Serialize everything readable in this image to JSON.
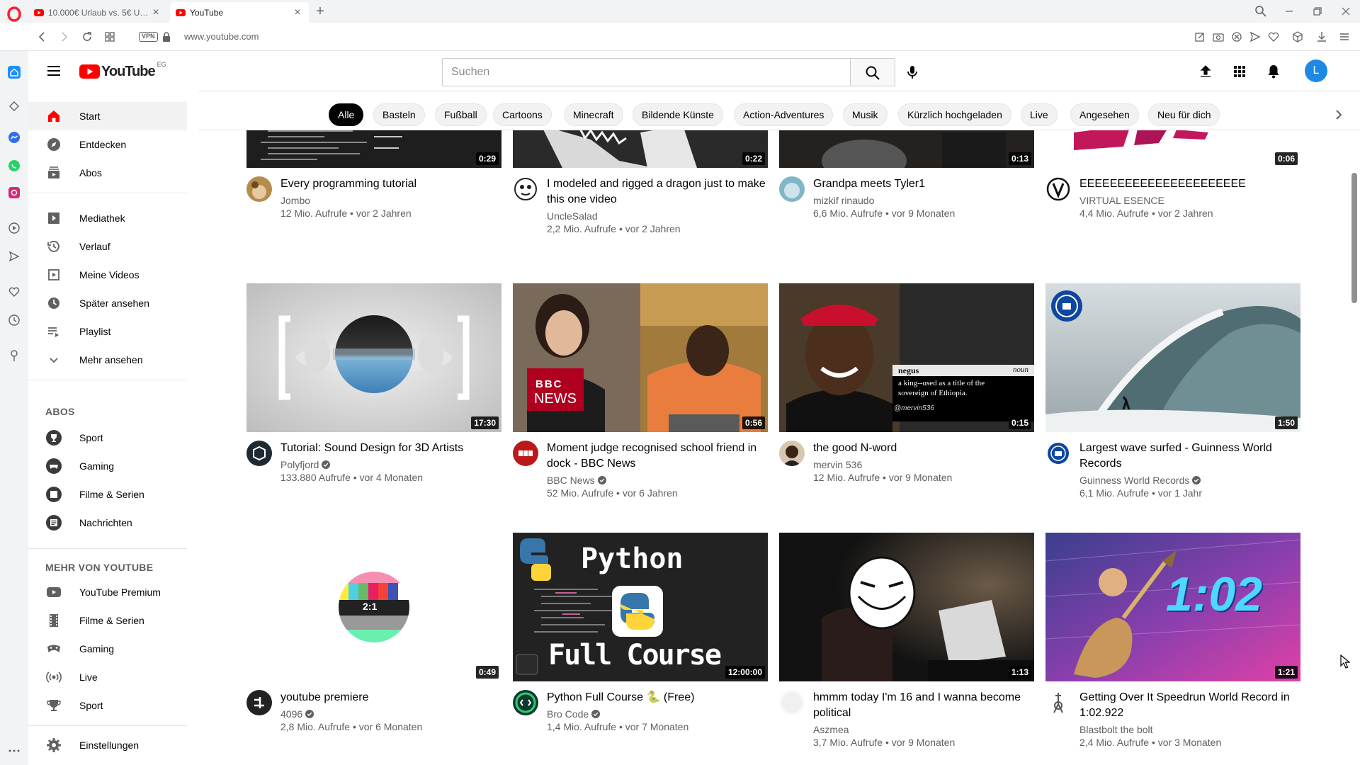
{
  "browser": {
    "tabs": [
      {
        "title": "10.000€ Urlaub vs. 5€ Urlaub",
        "active": false
      },
      {
        "title": "YouTube",
        "active": true
      }
    ],
    "vpn_label": "VPN",
    "url": "www.youtube.com"
  },
  "masthead": {
    "logo_word": "YouTube",
    "country_code": "EG",
    "search_placeholder": "Suchen",
    "avatar_initial": "L"
  },
  "guide": {
    "primary": [
      {
        "label": "Start",
        "icon": "home-icon",
        "active": true
      },
      {
        "label": "Entdecken",
        "icon": "compass-icon"
      },
      {
        "label": "Abos",
        "icon": "subscriptions-icon"
      }
    ],
    "library": [
      {
        "label": "Mediathek",
        "icon": "library-icon"
      },
      {
        "label": "Verlauf",
        "icon": "history-icon"
      },
      {
        "label": "Meine Videos",
        "icon": "your-videos-icon"
      },
      {
        "label": "Später ansehen",
        "icon": "watch-later-icon"
      },
      {
        "label": "Playlist",
        "icon": "playlist-icon"
      },
      {
        "label": "Mehr ansehen",
        "icon": "chevron-down-icon"
      }
    ],
    "subs_heading": "ABOS",
    "subscriptions": [
      {
        "label": "Sport",
        "icon": "sport-channel-icon"
      },
      {
        "label": "Gaming",
        "icon": "gaming-channel-icon"
      },
      {
        "label": "Filme & Serien",
        "icon": "movies-channel-icon"
      },
      {
        "label": "Nachrichten",
        "icon": "news-channel-icon"
      }
    ],
    "more_heading": "MEHR VON YOUTUBE",
    "more": [
      {
        "label": "YouTube Premium",
        "icon": "youtube-premium-icon"
      },
      {
        "label": "Filme & Serien",
        "icon": "film-icon"
      },
      {
        "label": "Gaming",
        "icon": "gamepad-icon"
      },
      {
        "label": "Live",
        "icon": "live-icon"
      },
      {
        "label": "Sport",
        "icon": "trophy-icon"
      }
    ],
    "settings": {
      "label": "Einstellungen",
      "icon": "gear-icon"
    }
  },
  "chips": [
    "Alle",
    "Basteln",
    "Fußball",
    "Cartoons",
    "Minecraft",
    "Bildende Künste",
    "Action-Adventures",
    "Musik",
    "Kürzlich hochgeladen",
    "Live",
    "Angesehen",
    "Neu für dich"
  ],
  "videos": [
    {
      "title": "Every programming tutorial",
      "channel": "Jombo",
      "verified": false,
      "stats": "12 Mio. Aufrufe • vor 2 Jahren",
      "duration": "0:29"
    },
    {
      "title": "I modeled and rigged a dragon just to make this one video",
      "channel": "UncleSalad",
      "verified": false,
      "stats": "2,2 Mio. Aufrufe • vor 2 Jahren",
      "duration": "0:22"
    },
    {
      "title": "Grandpa meets Tyler1",
      "channel": "mizkif rinaudo",
      "verified": false,
      "stats": "6,6 Mio. Aufrufe • vor 9 Monaten",
      "duration": "0:13"
    },
    {
      "title": "EEEEEEEEEEEEEEEEEEEEEE",
      "channel": "VIRTUAL ESENCE",
      "verified": false,
      "stats": "4,4 Mio. Aufrufe • vor 2 Jahren",
      "duration": "0:06"
    },
    {
      "title": "Tutorial: Sound Design for 3D Artists",
      "channel": "Polyfjord",
      "verified": true,
      "stats": "133.880 Aufrufe • vor 4 Monaten",
      "duration": "17:30"
    },
    {
      "title": "Moment judge recognised school friend in dock - BBC News",
      "channel": "BBC News",
      "verified": true,
      "stats": "52 Mio. Aufrufe • vor 6 Jahren",
      "duration": "0:56",
      "thumb_text": {
        "logo_top": "BBC",
        "logo_bottom": "NEWS"
      }
    },
    {
      "title": "the good N-word",
      "channel": "mervin 536",
      "verified": false,
      "stats": "12 Mio. Aufrufe • vor 9 Monaten",
      "duration": "0:15",
      "thumb_text": {
        "word": "negus",
        "pos": "noun",
        "definition_1": "a king--used as a title of the",
        "definition_2": "sovereign of Ethiopia.",
        "watermark": "@mervin536"
      }
    },
    {
      "title": "Largest wave surfed - Guinness World Records",
      "channel": "Guinness World Records",
      "verified": true,
      "stats": "6,1 Mio. Aufrufe • vor 1 Jahr",
      "duration": "1:50"
    },
    {
      "title": "youtube premiere",
      "channel": "4096",
      "verified": true,
      "stats": "2,8 Mio. Aufrufe • vor 6 Monaten",
      "duration": "0:49",
      "thumb_text": {
        "ratio": "2:1"
      }
    },
    {
      "title": "Python Full Course 🐍 (Free)",
      "channel": "Bro Code",
      "verified": true,
      "stats": "1,4 Mio. Aufrufe • vor 7 Monaten",
      "duration": "12:00:00",
      "thumb_text": {
        "top": "Python",
        "bottom": "Full Course"
      }
    },
    {
      "title": "hmmm today I'm 16 and I wanna become political",
      "channel": "Aszmea",
      "verified": false,
      "stats": "3,7 Mio. Aufrufe • vor 9 Monaten",
      "duration": "1:13"
    },
    {
      "title": "Getting Over It Speedrun World Record in 1:02.922",
      "channel": "Blastbolt the bolt",
      "verified": false,
      "stats": "2,4 Mio. Aufrufe • vor 3 Monaten",
      "duration": "1:21",
      "thumb_text": {
        "time": "1:02"
      }
    }
  ],
  "colors": {
    "yt_red": "#ff0000",
    "avatar_blue": "#1e88e5",
    "chip_selected": "#030303",
    "opera_red": "#ff1b2d"
  }
}
